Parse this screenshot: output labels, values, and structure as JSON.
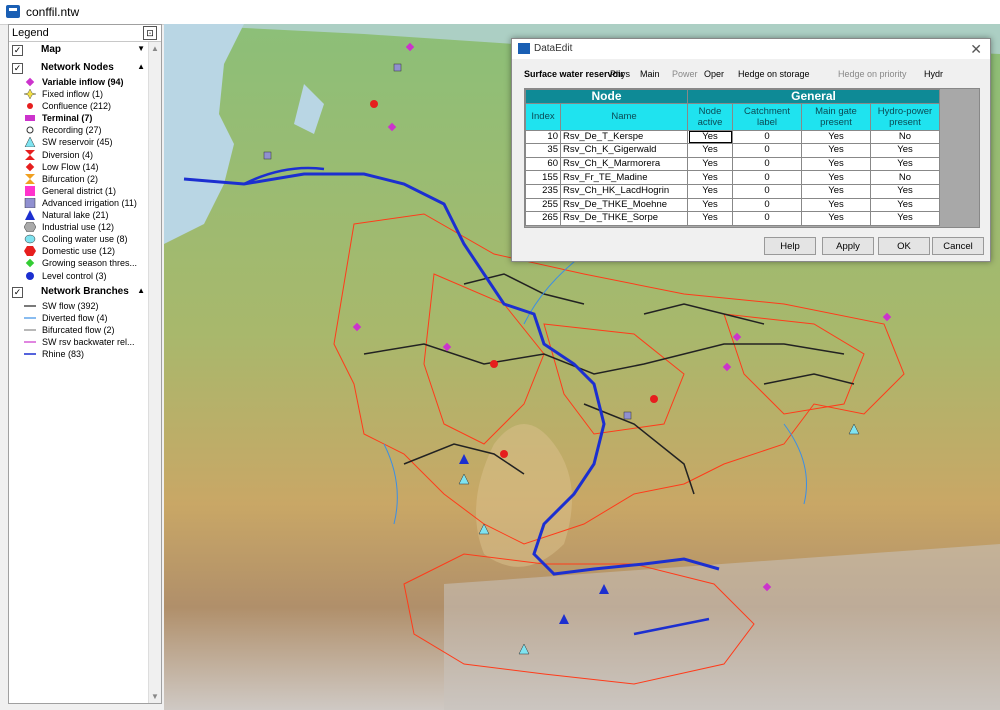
{
  "window": {
    "title": "conffil.ntw"
  },
  "legend": {
    "header": "Legend",
    "groups": [
      {
        "label": "Map",
        "items": []
      },
      {
        "label": "Network Nodes",
        "items": [
          {
            "label": "Variable inflow (94)",
            "bold": true
          },
          {
            "label": "Fixed inflow (1)"
          },
          {
            "label": "Confluence (212)"
          },
          {
            "label": "Terminal (7)",
            "bold": true
          },
          {
            "label": "Recording (27)"
          },
          {
            "label": "SW reservoir (45)"
          },
          {
            "label": "Diversion (4)"
          },
          {
            "label": "Low Flow (14)"
          },
          {
            "label": "Bifurcation (2)"
          },
          {
            "label": "General district (1)"
          },
          {
            "label": "Advanced irrigation (11)"
          },
          {
            "label": "Natural lake (21)"
          },
          {
            "label": "Industrial use (12)"
          },
          {
            "label": "Cooling water use (8)"
          },
          {
            "label": "Domestic use (12)"
          },
          {
            "label": "Growing season thres..."
          },
          {
            "label": "Level control (3)"
          }
        ]
      },
      {
        "label": "Network Branches",
        "items": [
          {
            "label": "SW flow (392)"
          },
          {
            "label": "Diverted flow (4)"
          },
          {
            "label": "Bifurcated flow (2)"
          },
          {
            "label": "SW rsv backwater rel..."
          },
          {
            "label": "Rhine (83)"
          }
        ]
      }
    ]
  },
  "dialog": {
    "title": "DataEdit",
    "tabs": [
      {
        "label": "Surface water reservoir",
        "state": "active"
      },
      {
        "label": "Phys"
      },
      {
        "label": "Main"
      },
      {
        "label": "Power",
        "state": "disabled"
      },
      {
        "label": "Oper"
      },
      {
        "label": "Hedge on storage"
      },
      {
        "label": "Hedge on priority",
        "state": "disabled"
      },
      {
        "label": "Hydr"
      }
    ],
    "table": {
      "group_node": "Node",
      "group_general": "General",
      "columns": [
        "Index",
        "Name",
        "Node active",
        "Catchment label",
        "Main gate present",
        "Hydro-power present"
      ],
      "rows": [
        {
          "index": "10",
          "name": "Rsv_De_T_Kerspe",
          "active": "Yes",
          "catchment": "0",
          "gate": "Yes",
          "hydro": "No"
        },
        {
          "index": "35",
          "name": "Rsv_Ch_K_Gigerwald",
          "active": "Yes",
          "catchment": "0",
          "gate": "Yes",
          "hydro": "Yes"
        },
        {
          "index": "60",
          "name": "Rsv_Ch_K_Marmorera",
          "active": "Yes",
          "catchment": "0",
          "gate": "Yes",
          "hydro": "Yes"
        },
        {
          "index": "155",
          "name": "Rsv_Fr_TE_Madine",
          "active": "Yes",
          "catchment": "0",
          "gate": "Yes",
          "hydro": "No"
        },
        {
          "index": "235",
          "name": "Rsv_Ch_HK_LacdHogrin",
          "active": "Yes",
          "catchment": "0",
          "gate": "Yes",
          "hydro": "Yes"
        },
        {
          "index": "255",
          "name": "Rsv_De_THKE_Moehne",
          "active": "Yes",
          "catchment": "0",
          "gate": "Yes",
          "hydro": "Yes"
        },
        {
          "index": "265",
          "name": "Rsv_De_THKE_Sorpe",
          "active": "Yes",
          "catchment": "0",
          "gate": "Yes",
          "hydro": "Yes"
        }
      ]
    },
    "buttons": {
      "help": "Help",
      "apply": "Apply",
      "ok": "OK",
      "cancel": "Cancel"
    }
  }
}
